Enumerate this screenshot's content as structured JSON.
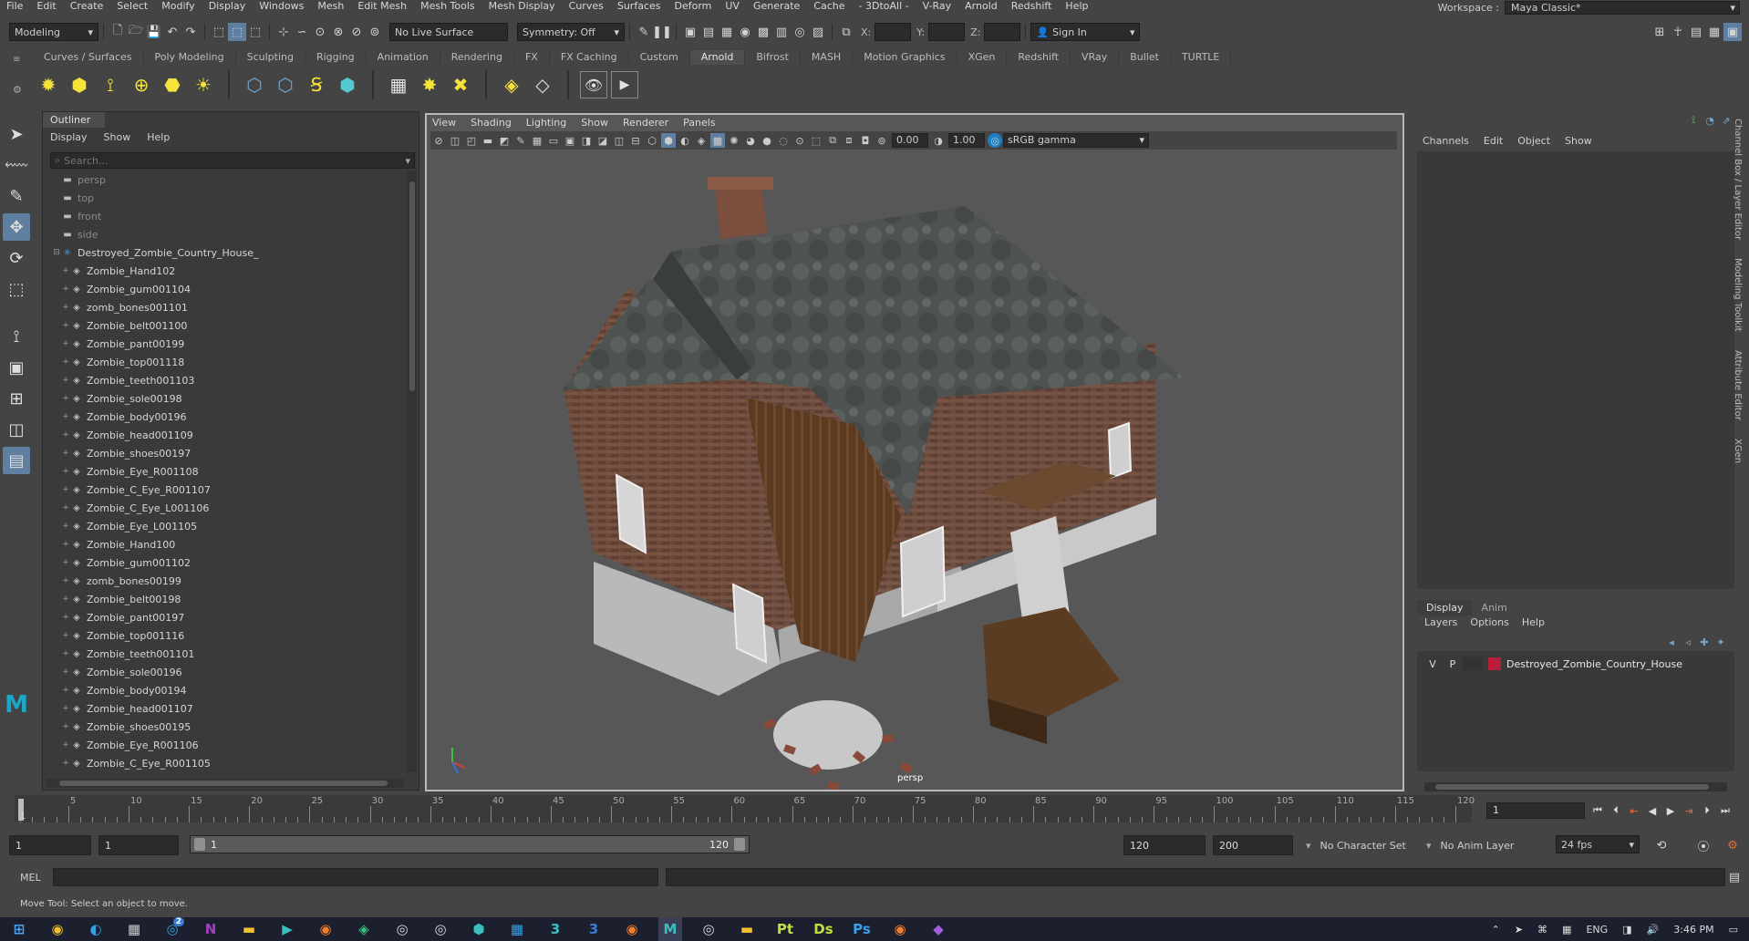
{
  "menubar": {
    "items": [
      "File",
      "Edit",
      "Create",
      "Select",
      "Modify",
      "Display",
      "Windows",
      "Mesh",
      "Edit Mesh",
      "Mesh Tools",
      "Mesh Display",
      "Curves",
      "Surfaces",
      "Deform",
      "UV",
      "Generate",
      "Cache",
      "- 3DtoAll -",
      "V-Ray",
      "Arnold",
      "Redshift",
      "Help"
    ],
    "workspace_label": "Workspace :",
    "workspace_value": "Maya Classic*"
  },
  "statusline": {
    "mode": "Modeling",
    "live_surface": "No Live Surface",
    "symmetry": "Symmetry: Off",
    "x_label": "X:",
    "y_label": "Y:",
    "z_label": "Z:",
    "sign_in": "Sign In"
  },
  "shelf_tabs": [
    "Curves / Surfaces",
    "Poly Modeling",
    "Sculpting",
    "Rigging",
    "Animation",
    "Rendering",
    "FX",
    "FX Caching",
    "Custom",
    "Arnold",
    "Bifrost",
    "MASH",
    "Motion Graphics",
    "XGen",
    "Redshift",
    "VRay",
    "Bullet",
    "TURTLE"
  ],
  "shelf_active": "Arnold",
  "outliner": {
    "title": "Outliner",
    "menu": [
      "Display",
      "Show",
      "Help"
    ],
    "search_placeholder": "Search...",
    "cameras": [
      "persp",
      "top",
      "front",
      "side"
    ],
    "root": "Destroyed_Zombie_Country_House_",
    "items": [
      "Zombie_Hand102",
      "Zombie_gum001104",
      "zomb_bones001101",
      "Zombie_belt001100",
      "Zombie_pant00199",
      "Zombie_top001118",
      "Zombie_teeth001103",
      "Zombie_sole00198",
      "Zombie_body00196",
      "Zombie_head001109",
      "Zombie_shoes00197",
      "Zombie_Eye_R001108",
      "Zombie_C_Eye_R001107",
      "Zombie_C_Eye_L001106",
      "Zombie_Eye_L001105",
      "Zombie_Hand100",
      "Zombie_gum001102",
      "zomb_bones00199",
      "Zombie_belt00198",
      "Zombie_pant00197",
      "Zombie_top001116",
      "Zombie_teeth001101",
      "Zombie_sole00196",
      "Zombie_body00194",
      "Zombie_head001107",
      "Zombie_shoes00195",
      "Zombie_Eye_R001106",
      "Zombie_C_Eye_R001105"
    ]
  },
  "viewport": {
    "menu": [
      "View",
      "Shading",
      "Lighting",
      "Show",
      "Renderer",
      "Panels"
    ],
    "exposure": "0.00",
    "gamma_value": "1.00",
    "color_space": "sRGB gamma",
    "camera_label": "persp"
  },
  "channelbox": {
    "menu": [
      "Channels",
      "Edit",
      "Object",
      "Show"
    ],
    "layer_tabs": [
      "Display",
      "Anim"
    ],
    "layer_menu": [
      "Layers",
      "Options",
      "Help"
    ],
    "layer": {
      "v": "V",
      "p": "P",
      "name": "Destroyed_Zombie_Country_House",
      "color": "#b71c3a"
    }
  },
  "side_tabs": [
    "Channel Box / Layer Editor",
    "Modeling Toolkit",
    "Attribute Editor",
    "XGen"
  ],
  "timeline": {
    "labels": [
      "5",
      "10",
      "15",
      "20",
      "25",
      "30",
      "35",
      "40",
      "45",
      "50",
      "55",
      "60",
      "65",
      "70",
      "75",
      "80",
      "85",
      "90",
      "95",
      "100",
      "105",
      "110",
      "115",
      "120"
    ],
    "start_marker": "1",
    "current_frame": "1"
  },
  "range": {
    "start": "1",
    "playback_start": "1",
    "slider_start": "1",
    "slider_end": "120",
    "playback_end": "120",
    "end": "200",
    "character_set": "No Character Set",
    "anim_layer": "No Anim Layer",
    "fps": "24 fps"
  },
  "cmdline": {
    "label": "MEL",
    "help": "Move Tool: Select an object to move."
  },
  "taskbar": {
    "clock": "3:46 PM",
    "lang": "ENG",
    "badge": "2",
    "ps_label": "Pt",
    "ds_label": "Ds",
    "photoshop_label": "Ps",
    "num3a": "3",
    "num3b": "3"
  }
}
